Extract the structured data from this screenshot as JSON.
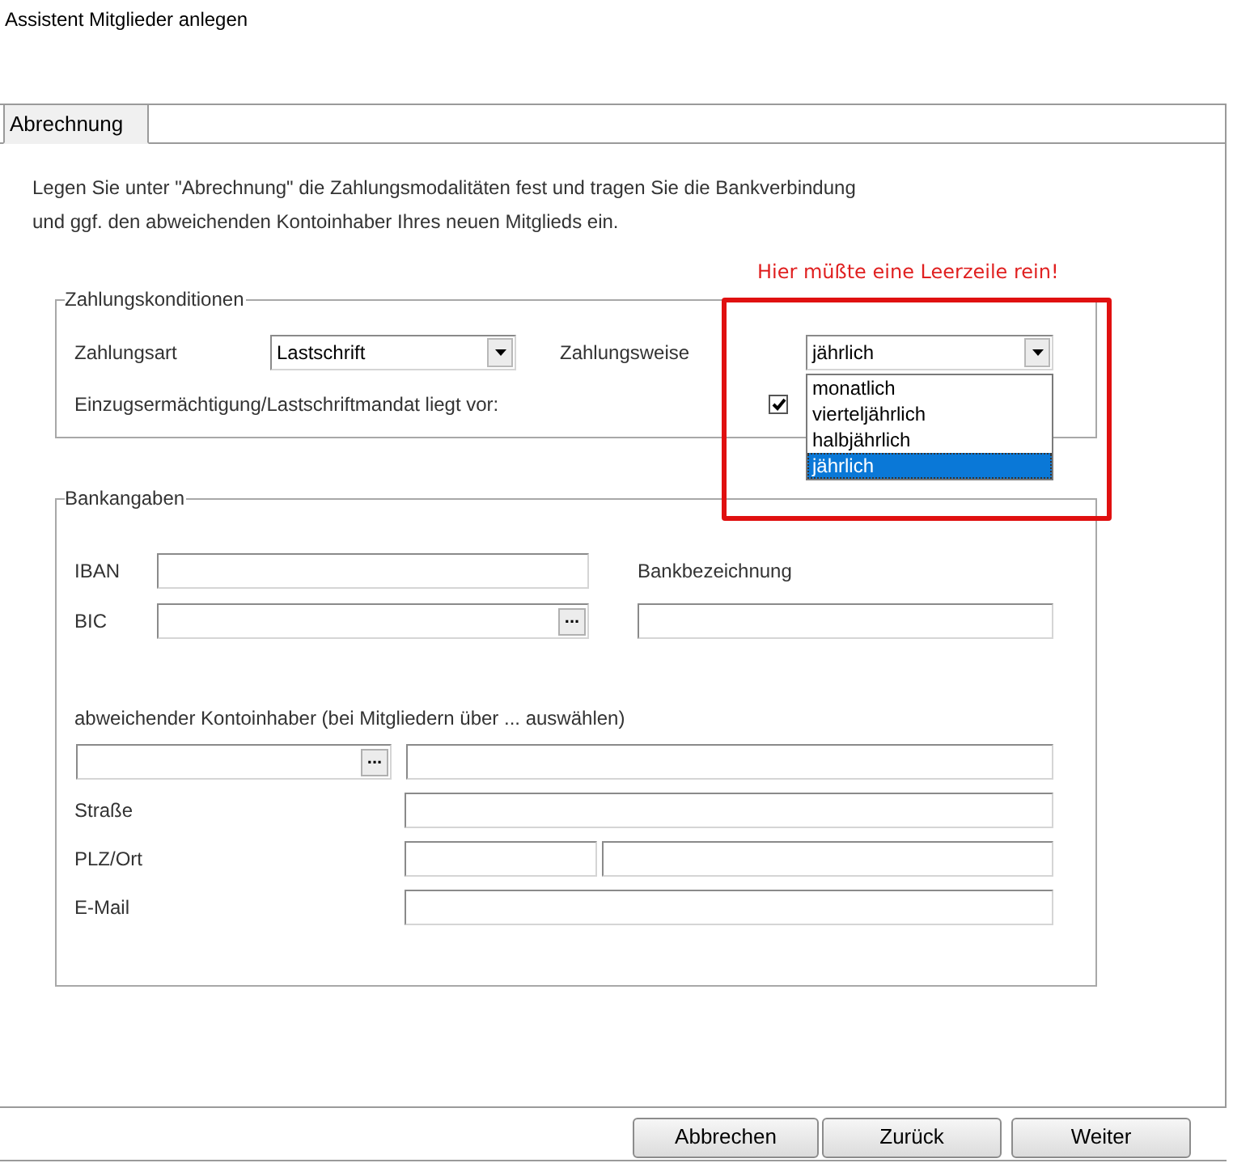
{
  "window": {
    "title": "Assistent Mitglieder anlegen"
  },
  "tabs": [
    {
      "label": "Abrechnung",
      "selected": true
    }
  ],
  "description_lines": [
    "Legen Sie unter \"Abrechnung\" die Zahlungsmodalitäten fest und tragen Sie die Bankverbindung",
    "und ggf. den abweichenden Kontoinhaber Ihres neuen Mitglieds ein."
  ],
  "annotation": {
    "text": "Hier müßte eine Leerzeile rein!"
  },
  "payment_conditions": {
    "legend": "Zahlungskonditionen",
    "payment_type": {
      "label": "Zahlungsart",
      "value": "Lastschrift"
    },
    "payment_interval": {
      "label": "Zahlungsweise",
      "value": "jährlich",
      "expanded": true,
      "options": [
        {
          "label": "monatlich",
          "selected": false
        },
        {
          "label": "vierteljährlich",
          "selected": false
        },
        {
          "label": "halbjährlich",
          "selected": false
        },
        {
          "label": "jährlich",
          "selected": true
        }
      ]
    },
    "mandate": {
      "label": "Einzugsermächtigung/Lastschriftmandat liegt vor:",
      "checked": true
    }
  },
  "bank_details": {
    "legend": "Bankangaben",
    "iban_label": "IBAN",
    "bic_label": "BIC",
    "bank_name_label": "Bankbezeichnung",
    "holder_label": "abweichender Kontoinhaber (bei Mitgliedern über ... auswählen)",
    "picker_button": "...",
    "street_label": "Straße",
    "city_label": "PLZ/Ort",
    "email_label": "E-Mail"
  },
  "buttons": [
    {
      "label": "Abbrechen"
    },
    {
      "label": "Zurück"
    },
    {
      "label": "Weiter"
    }
  ]
}
